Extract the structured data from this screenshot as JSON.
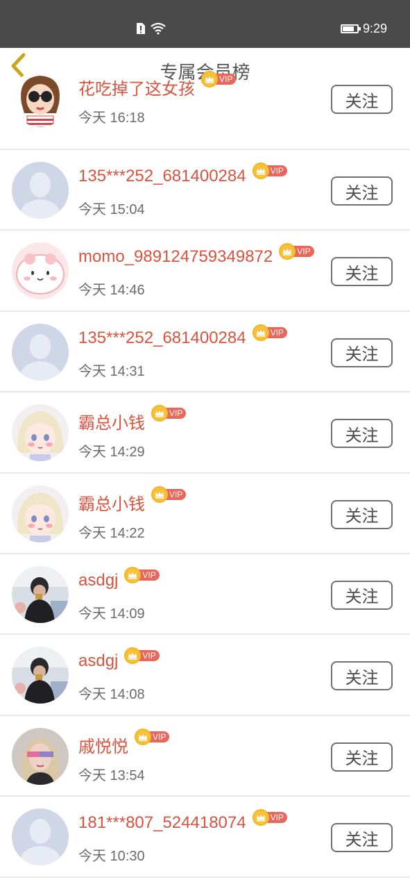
{
  "status_bar": {
    "time": "9:29",
    "battery_level": 0.8,
    "icons": [
      "sim-alert-icon",
      "wifi-icon",
      "battery-icon"
    ]
  },
  "header": {
    "title": "专属会员榜",
    "back_icon": "chevron-left-icon"
  },
  "colors": {
    "username": "#d9533f",
    "vip_badge": "#e8665a",
    "crown": "#f6c23a",
    "back_chevron": "#c9a520"
  },
  "members": [
    {
      "name": "花吃掉了这女孩",
      "vip_label": "VIP",
      "time": "今天 16:18",
      "follow_label": "关注",
      "avatar": "cartoon-girl-glasses"
    },
    {
      "name": "135***252_681400284",
      "vip_label": "VIP",
      "time": "今天 15:04",
      "follow_label": "关注",
      "avatar": "default-person"
    },
    {
      "name": "momo_989124759349872",
      "vip_label": "VIP",
      "time": "今天 14:46",
      "follow_label": "关注",
      "avatar": "pink-blob"
    },
    {
      "name": "135***252_681400284",
      "vip_label": "VIP",
      "time": "今天 14:31",
      "follow_label": "关注",
      "avatar": "default-person"
    },
    {
      "name": "霸总小钱",
      "vip_label": "VIP",
      "time": "今天 14:29",
      "follow_label": "关注",
      "avatar": "anime-girl"
    },
    {
      "name": "霸总小钱",
      "vip_label": "VIP",
      "time": "今天 14:22",
      "follow_label": "关注",
      "avatar": "anime-girl"
    },
    {
      "name": "asdgj",
      "vip_label": "VIP",
      "time": "今天 14:09",
      "follow_label": "关注",
      "avatar": "man-photo"
    },
    {
      "name": "asdgj",
      "vip_label": "VIP",
      "time": "今天 14:08",
      "follow_label": "关注",
      "avatar": "man-photo"
    },
    {
      "name": "戚悦悦",
      "vip_label": "VIP",
      "time": "今天 13:54",
      "follow_label": "关注",
      "avatar": "woman-photo"
    },
    {
      "name": "181***807_524418074",
      "vip_label": "VIP",
      "time": "今天 10:30",
      "follow_label": "关注",
      "avatar": "default-person"
    }
  ]
}
